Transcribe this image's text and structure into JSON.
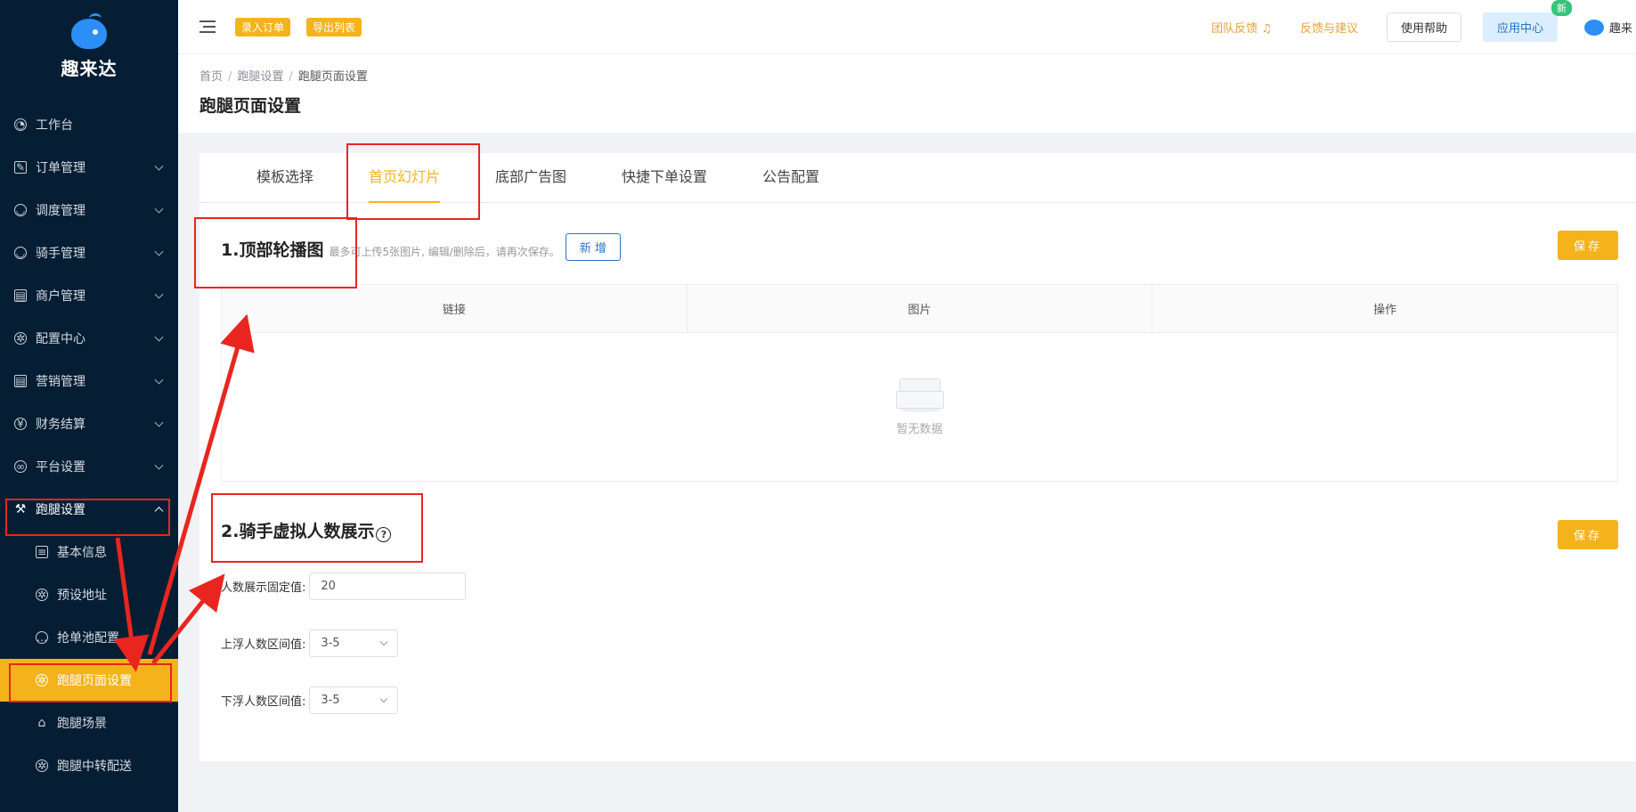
{
  "sidebar": {
    "brand": "趣来达",
    "items": [
      {
        "label": "工作台",
        "icon": "dashboard-icon"
      },
      {
        "label": "订单管理",
        "icon": "edit-icon"
      },
      {
        "label": "调度管理",
        "icon": "user-icon"
      },
      {
        "label": "骑手管理",
        "icon": "rider-icon"
      },
      {
        "label": "商户管理",
        "icon": "shop-icon"
      },
      {
        "label": "配置中心",
        "icon": "gear-icon"
      },
      {
        "label": "营销管理",
        "icon": "shop-icon"
      },
      {
        "label": "财务结算",
        "icon": "yen-icon"
      },
      {
        "label": "平台设置",
        "icon": "wechat-icon"
      },
      {
        "label": "跑腿设置",
        "icon": "wrench-icon"
      }
    ],
    "sub_items": [
      {
        "label": "基本信息",
        "icon": "document-icon"
      },
      {
        "label": "预设地址",
        "icon": "gear-icon"
      },
      {
        "label": "抢单池配置",
        "icon": "chat-icon"
      },
      {
        "label": "跑腿页面设置",
        "icon": "gear-icon"
      },
      {
        "label": "跑腿场景",
        "icon": "home-icon"
      },
      {
        "label": "跑腿中转配送",
        "icon": "gear-icon"
      }
    ]
  },
  "topbar": {
    "tag_import": "录入订单",
    "tag_export": "导出列表",
    "team_feedback": "团队反馈",
    "feedback": "反馈与建议",
    "help": "使用帮助",
    "app_center": "应用中心",
    "new_badge": "新",
    "user": "趣来"
  },
  "breadcrumb": [
    "首页",
    "跑腿设置",
    "跑腿页面设置"
  ],
  "page_title": "跑腿页面设置",
  "tabs": [
    "模板选择",
    "首页幻灯片",
    "底部广告图",
    "快捷下单设置",
    "公告配置"
  ],
  "active_tab": "首页幻灯片",
  "section1": {
    "title": "1.顶部轮播图",
    "hint": "最多可上传5张图片, 编辑/删除后，请再次保存。",
    "add_label": "新 增",
    "save_label": "保存",
    "columns": [
      "链接",
      "图片",
      "操作"
    ],
    "empty_text": "暂无数据"
  },
  "section2": {
    "title": "2.骑手虚拟人数展示",
    "help_glyph": "?",
    "save_label": "保存",
    "fixed_label": "人数展示固定值:",
    "fixed_value": "20",
    "up_label": "上浮人数区间值:",
    "up_value": "3-5",
    "down_label": "下浮人数区间值:",
    "down_value": "3-5"
  },
  "colors": {
    "accent": "#f5b31b",
    "sidebar": "#061e34",
    "annotation": "#e8261f"
  }
}
